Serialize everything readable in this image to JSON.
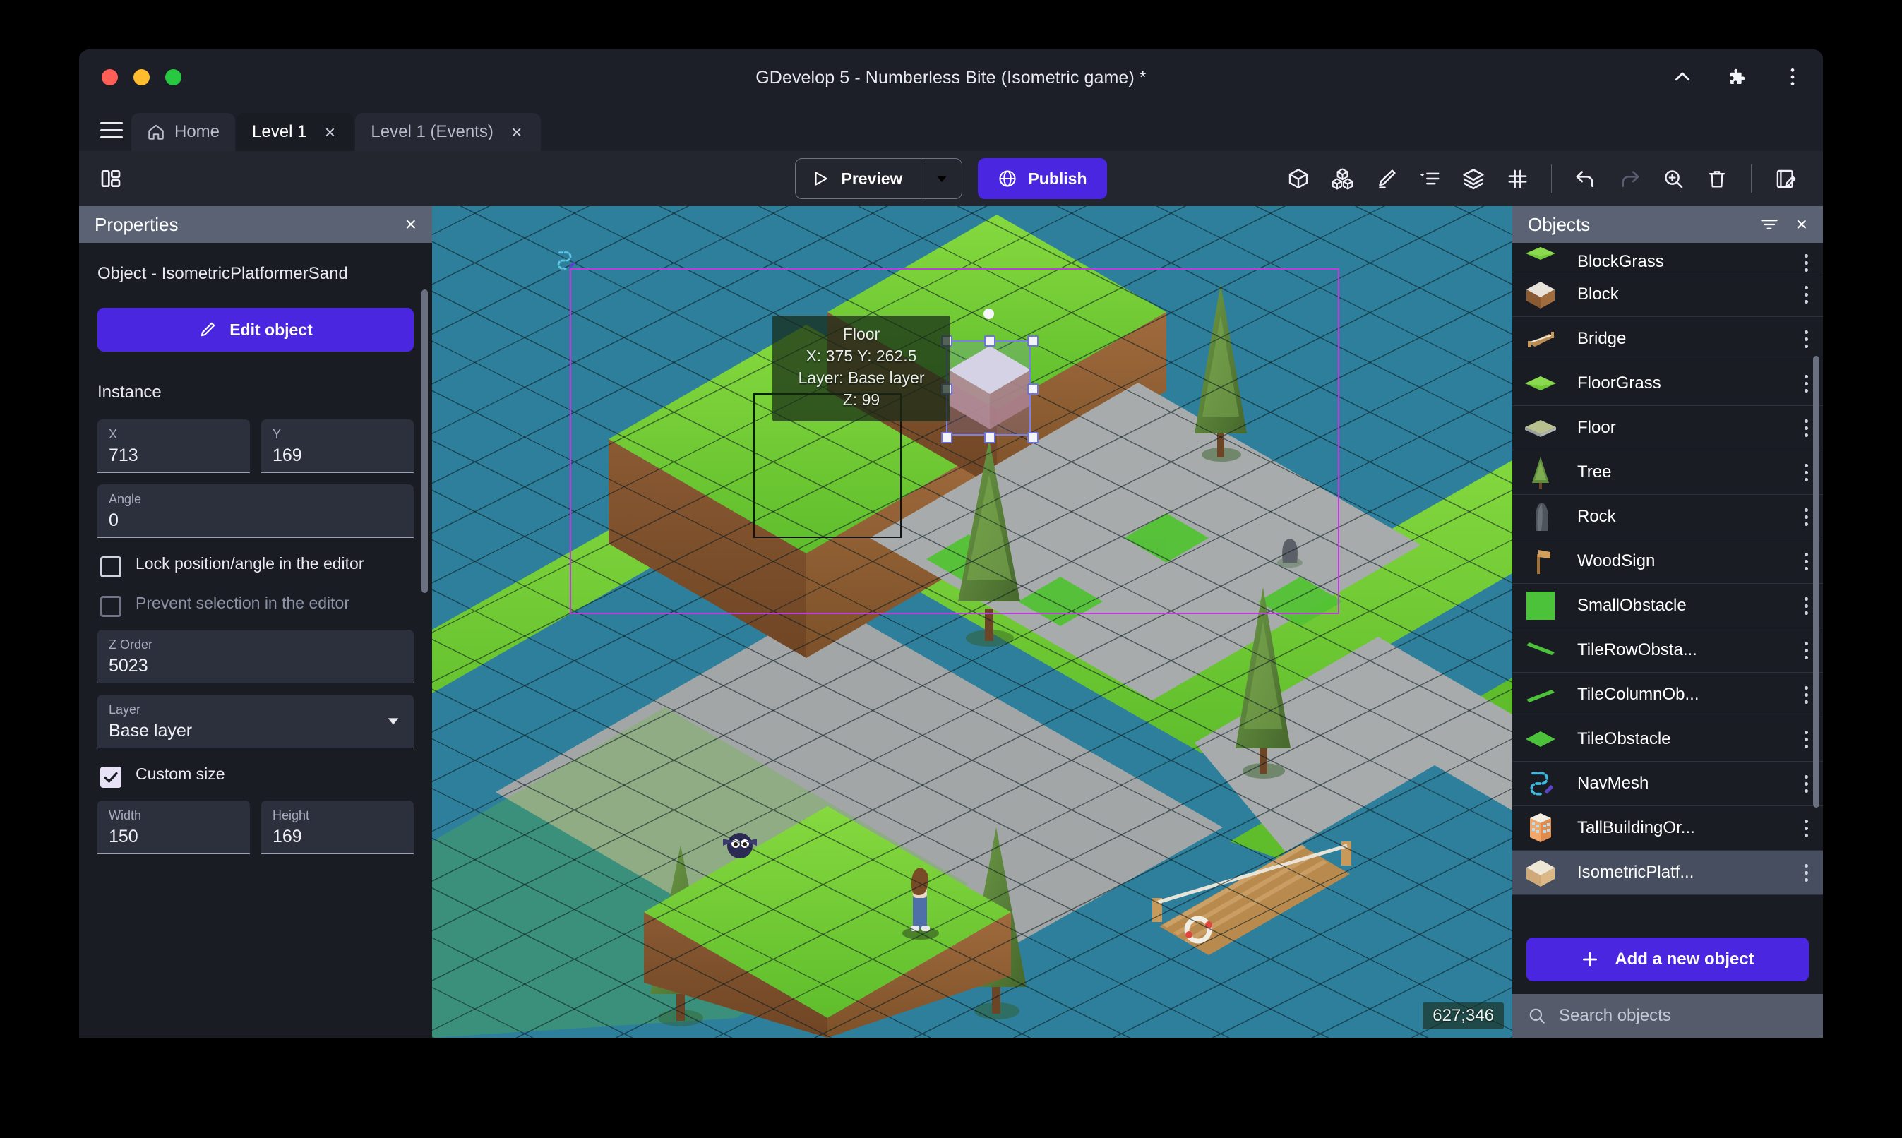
{
  "window": {
    "title": "GDevelop 5 - Numberless Bite (Isometric game) *",
    "traffic_lights": [
      "close",
      "minimize",
      "maximize"
    ],
    "actions": [
      {
        "name": "collapse-chevron-icon",
        "label": "^"
      },
      {
        "name": "extensions-puzzle-icon",
        "label": "puzzle"
      },
      {
        "name": "more-options-icon",
        "label": "kebab"
      }
    ]
  },
  "tabs": {
    "menu_label": "menu",
    "items": [
      {
        "label": "Home",
        "icon": "home-icon",
        "active": false,
        "closable": false
      },
      {
        "label": "Level 1",
        "icon": "",
        "active": true,
        "closable": true
      },
      {
        "label": "Level 1 (Events)",
        "icon": "",
        "active": false,
        "closable": true
      }
    ],
    "close_glyph": "×"
  },
  "toolbar": {
    "layout_toggle": "panel-layout-icon",
    "preview_label": "Preview",
    "preview_caret": "▼",
    "publish_label": "Publish",
    "icons": [
      {
        "name": "object-cube-icon",
        "title": "3D object"
      },
      {
        "name": "objects-group-icon",
        "title": "Objects"
      },
      {
        "name": "draw-pencil-icon",
        "title": "Draw"
      },
      {
        "name": "instances-list-icon",
        "title": "Instances"
      },
      {
        "name": "layers-icon",
        "title": "Layers"
      },
      {
        "name": "grid-icon",
        "title": "Grid"
      },
      {
        "name": "undo-icon",
        "title": "Undo"
      },
      {
        "name": "redo-icon",
        "title": "Redo",
        "disabled": true
      },
      {
        "name": "zoom-in-icon",
        "title": "Zoom"
      },
      {
        "name": "trash-icon",
        "title": "Delete"
      },
      {
        "name": "edit-scene-icon",
        "title": "Open scene editor"
      }
    ]
  },
  "properties": {
    "panel_title": "Properties",
    "close_glyph": "×",
    "object_line": "Object  - IsometricPlatformerSand",
    "edit_object_label": "Edit object",
    "instance_section": "Instance",
    "fields": {
      "x": {
        "label": "X",
        "value": "713"
      },
      "y": {
        "label": "Y",
        "value": "169"
      },
      "angle": {
        "label": "Angle",
        "value": "0"
      },
      "z_order": {
        "label": "Z Order",
        "value": "5023"
      },
      "layer": {
        "label": "Layer",
        "value": "Base layer"
      },
      "width": {
        "label": "Width",
        "value": "150"
      },
      "height": {
        "label": "Height",
        "value": "169"
      }
    },
    "checkboxes": [
      {
        "label": "Lock position/angle in the editor",
        "checked": false,
        "disabled": false
      },
      {
        "label": "Prevent selection in the editor",
        "checked": false,
        "disabled": true
      },
      {
        "label": "Custom size",
        "checked": true,
        "disabled": false
      }
    ]
  },
  "canvas": {
    "tooltip": {
      "name": "Floor",
      "coords": "X: 375  Y: 262.5",
      "layer": "Layer: Base layer",
      "z": "Z: 99"
    },
    "coordinates": "627;346",
    "accent_selection": "#7b7fe8",
    "scene_bounds_color": "#c13ae0",
    "water_color": "#2e7f9b",
    "grass_color": "#6ec832",
    "path_color": "#a2a6a7",
    "dirt_color": "#8a5a33"
  },
  "objects": {
    "panel_title": "Objects",
    "filter_icon": "filter-icon",
    "close_glyph": "×",
    "add_button_label": "Add a new object",
    "add_button_glyph": "+",
    "search_placeholder": "Search objects",
    "search_icon": "search-icon",
    "items": [
      {
        "label": "BlockGrass",
        "thumb": "grass-slab",
        "partial": true,
        "selected": false
      },
      {
        "label": "Block",
        "thumb": "dirt-block",
        "partial": false,
        "selected": false
      },
      {
        "label": "Bridge",
        "thumb": "bridge",
        "partial": false,
        "selected": false
      },
      {
        "label": "FloorGrass",
        "thumb": "grass-slab",
        "partial": false,
        "selected": false
      },
      {
        "label": "Floor",
        "thumb": "stone-slab",
        "partial": false,
        "selected": false
      },
      {
        "label": "Tree",
        "thumb": "tree",
        "partial": false,
        "selected": false
      },
      {
        "label": "Rock",
        "thumb": "rock",
        "partial": false,
        "selected": false
      },
      {
        "label": "WoodSign",
        "thumb": "wood-sign",
        "partial": false,
        "selected": false
      },
      {
        "label": "SmallObstacle",
        "thumb": "green-square",
        "partial": false,
        "selected": false
      },
      {
        "label": "TileRowObsta...",
        "thumb": "green-bar-right",
        "partial": false,
        "selected": false
      },
      {
        "label": "TileColumnOb...",
        "thumb": "green-bar-left",
        "partial": false,
        "selected": false
      },
      {
        "label": "TileObstacle",
        "thumb": "green-diamond",
        "partial": false,
        "selected": false
      },
      {
        "label": "NavMesh",
        "thumb": "navmesh",
        "partial": false,
        "selected": false
      },
      {
        "label": "TallBuildingOr...",
        "thumb": "building",
        "partial": false,
        "selected": false
      },
      {
        "label": "IsometricPlatf...",
        "thumb": "sand-block",
        "partial": false,
        "selected": true
      }
    ]
  }
}
